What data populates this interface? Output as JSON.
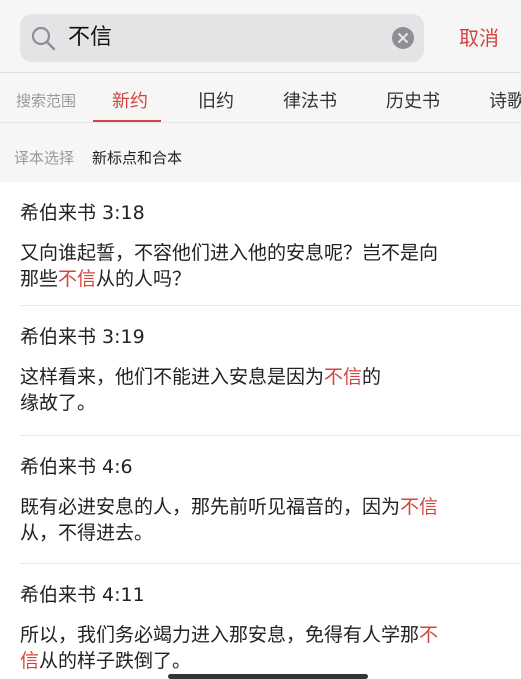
{
  "search": {
    "value": "不信",
    "cancel_label": "取消"
  },
  "range": {
    "label": "搜索范围",
    "tabs": [
      {
        "label": "新约",
        "active": true
      },
      {
        "label": "旧约",
        "active": false
      },
      {
        "label": "律法书",
        "active": false
      },
      {
        "label": "历史书",
        "active": false
      },
      {
        "label": "诗歌",
        "active": false
      }
    ]
  },
  "version": {
    "label": "译本选择",
    "value": "新标点和合本"
  },
  "results": [
    {
      "ref": "希伯来书 3:18",
      "line1_pre": "又向谁起誓，不容他们进入他的安息呢？岂不是向",
      "line2_pre": "那些",
      "hl2": "不信",
      "line2_post": "从的人吗？"
    },
    {
      "ref": "希伯来书 3:19",
      "line1_pre": "这样看来，他们不能进入安息是因为",
      "hl1": "不信",
      "line1_post": "的",
      "line2_pre": "缘故了。"
    },
    {
      "ref": "希伯来书 4:6",
      "line1_pre": "既有必进安息的人，那先前听见福音的，因为",
      "hl1": "不信",
      "line2_pre": "从，不得进去。"
    },
    {
      "ref": "希伯来书 4:11",
      "line1_pre": "所以，我们务必竭力进入那安息，免得有人学那",
      "hl1": "不",
      "hl2": "信",
      "line2_post": "从的样子跌倒了。"
    }
  ],
  "colors": {
    "accent": "#d0463f",
    "background": "#f6f6f6"
  },
  "icons": {
    "search": "search-icon",
    "clear": "clear-icon"
  }
}
